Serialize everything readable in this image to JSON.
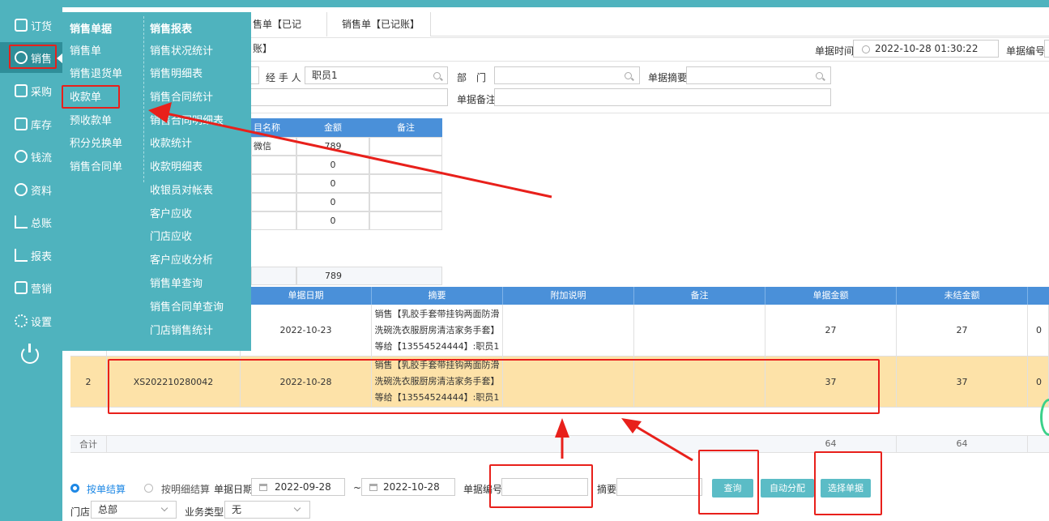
{
  "sidebar": {
    "items": [
      {
        "label": "订货",
        "icon": "clipboard-icon"
      },
      {
        "label": "销售",
        "icon": "user-icon"
      },
      {
        "label": "采购",
        "icon": "cart-icon"
      },
      {
        "label": "库存",
        "icon": "box-icon"
      },
      {
        "label": "钱流",
        "icon": "money-bag-icon"
      },
      {
        "label": "资料",
        "icon": "users-icon"
      },
      {
        "label": "总账",
        "icon": "line-chart-icon"
      },
      {
        "label": "报表",
        "icon": "report-chart-icon"
      },
      {
        "label": "营销",
        "icon": "marketing-icon"
      },
      {
        "label": "设置",
        "icon": "gear-icon"
      }
    ],
    "power_icon": "power-icon"
  },
  "flyout": {
    "col1_title": "销售单据",
    "col1": [
      "销售单",
      "销售退货单",
      "收款单",
      "预收款单",
      "积分兑换单",
      "销售合同单"
    ],
    "col2_title": "销售报表",
    "col2": [
      "销售状况统计",
      "销售明细表",
      "销售合同统计",
      "销售合同明细表",
      "收款统计",
      "收款明细表",
      "收银员对帐表",
      "客户应收",
      "门店应收",
      "客户应收分析",
      "销售单查询",
      "销售合同单查询",
      "门店销售统计"
    ]
  },
  "tabs": [
    "售单【已记账】",
    "销售单【已记账】"
  ],
  "form": {
    "doc_time_label": "单据时间",
    "doc_time_value": "2022-10-28 01:30:22",
    "doc_no_label": "单据编号",
    "handler_label": "经 手 人",
    "handler_value": "职员1",
    "dept_label": "部　门",
    "summary_label": "单据摘要",
    "remark_label": "单据备注"
  },
  "upper_table": {
    "headers": [
      "目名称",
      "金额",
      "备注"
    ],
    "rows": [
      {
        "name": "微信",
        "amount": "789"
      },
      {
        "name": "",
        "amount": "0"
      },
      {
        "name": "",
        "amount": "0"
      },
      {
        "name": "",
        "amount": "0"
      },
      {
        "name": "",
        "amount": "0"
      }
    ],
    "total": "789"
  },
  "lower_table": {
    "headers": [
      "单据日期",
      "摘要",
      "附加说明",
      "备注",
      "单据金额",
      "未结金额"
    ],
    "rows": [
      {
        "no": "",
        "code": "",
        "date": "2022-10-23",
        "memo": [
          "销售【乳胶手套带挂钩两面防滑",
          "洗碗洗衣服厨房清洁家务手套】",
          "等给【13554524444】:职员1"
        ],
        "amount": "27",
        "unsettled": "27",
        "extra": "0"
      },
      {
        "no": "2",
        "code": "XS202210280042",
        "date": "2022-10-28",
        "memo": [
          "销售【乳胶手套带挂钩两面防滑",
          "洗碗洗衣服厨房清洁家务手套】",
          "等给【13554524444】:职员1"
        ],
        "amount": "37",
        "unsettled": "37",
        "extra": "0"
      }
    ],
    "total_label": "合计",
    "total_amount": "64",
    "total_unsettled": "64"
  },
  "bottom": {
    "radio1": "按单结算",
    "radio2": "按明细结算",
    "date_label": "单据日期",
    "date_from": "2022-09-28",
    "tilde": "~",
    "date_to": "2022-10-28",
    "docno_label": "单据编号",
    "summary_label": "摘要",
    "query_btn": "查询",
    "auto_btn": "自动分配",
    "select_btn": "选择单据",
    "store_label": "门店",
    "store_value": "总部",
    "biz_label": "业务类型",
    "biz_value": "无"
  },
  "colors": {
    "sidebar": "#4fb3be",
    "table_head": "#4a90d9",
    "highlight_row": "#fde2a8",
    "annotation": "#e8201b"
  }
}
